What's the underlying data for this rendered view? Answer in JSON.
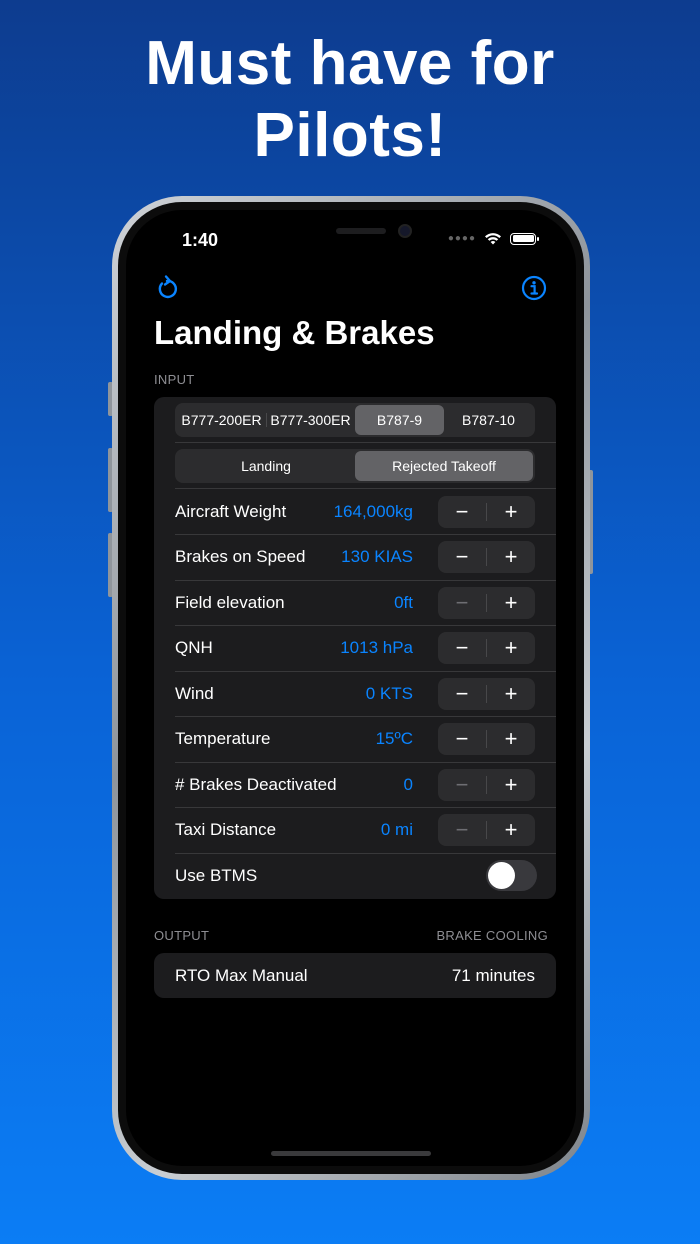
{
  "promo": {
    "headline_line1": "Must have for",
    "headline_line2": "Pilots!"
  },
  "status_bar": {
    "time": "1:40"
  },
  "nav": {
    "back_icon": "refresh-back-icon",
    "info_icon": "info-icon"
  },
  "page_title": "Landing & Brakes",
  "input_section": {
    "header": "INPUT",
    "aircraft_options": [
      "B777-200ER",
      "B777-300ER",
      "B787-9",
      "B787-10"
    ],
    "aircraft_selected": "B787-9",
    "mode_options": [
      "Landing",
      "Rejected Takeoff"
    ],
    "mode_selected": "Rejected Takeoff",
    "rows": [
      {
        "label": "Aircraft Weight",
        "value": "164,000kg",
        "minus_enabled": true
      },
      {
        "label": "Brakes on Speed",
        "value": "130 KIAS",
        "minus_enabled": true
      },
      {
        "label": "Field elevation",
        "value": "0ft",
        "minus_enabled": false
      },
      {
        "label": "QNH",
        "value": "1013 hPa",
        "minus_enabled": true
      },
      {
        "label": "Wind",
        "value": "0 KTS",
        "minus_enabled": true
      },
      {
        "label": "Temperature",
        "value": "15ºC",
        "minus_enabled": true
      },
      {
        "label": "# Brakes Deactivated",
        "value": "0",
        "minus_enabled": false
      },
      {
        "label": "Taxi Distance",
        "value": "0 mi",
        "minus_enabled": false
      }
    ],
    "btms": {
      "label": "Use BTMS",
      "on": false
    }
  },
  "output_section": {
    "header_left": "OUTPUT",
    "header_right": "BRAKE COOLING",
    "result_label": "RTO Max Manual",
    "result_value": "71 minutes"
  },
  "colors": {
    "accent": "#0a84ff",
    "background_top": "#0d3c8f",
    "background_bottom": "#0b7df5"
  }
}
